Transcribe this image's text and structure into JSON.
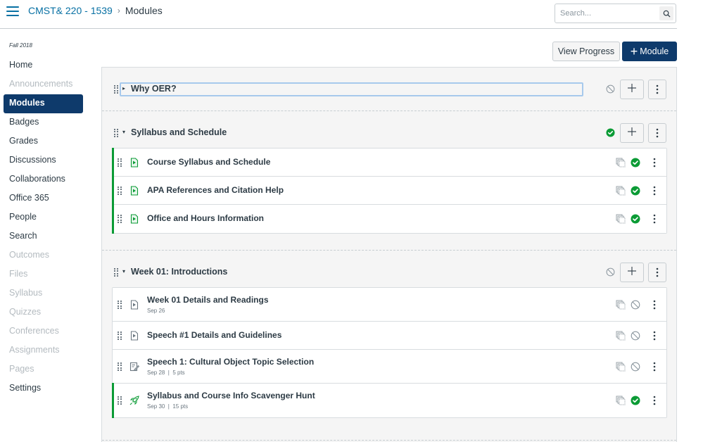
{
  "header": {
    "menu_icon": "hamburger-icon",
    "breadcrumbs": [
      {
        "label": "CMST& 220 - 1539",
        "link": true
      },
      {
        "label": "Modules",
        "link": false
      }
    ],
    "separator": "›",
    "search": {
      "placeholder": "Search...",
      "value": "",
      "icon": "search-icon"
    }
  },
  "sidebar": {
    "term": "Fall 2018",
    "items": [
      {
        "label": "Home",
        "state": "enabled"
      },
      {
        "label": "Announcements",
        "state": "disabled"
      },
      {
        "label": "Modules",
        "state": "active"
      },
      {
        "label": "Badges",
        "state": "enabled"
      },
      {
        "label": "Grades",
        "state": "enabled"
      },
      {
        "label": "Discussions",
        "state": "enabled"
      },
      {
        "label": "Collaborations",
        "state": "enabled"
      },
      {
        "label": "Office 365",
        "state": "enabled"
      },
      {
        "label": "People",
        "state": "enabled"
      },
      {
        "label": "Search",
        "state": "enabled"
      },
      {
        "label": "Outcomes",
        "state": "disabled"
      },
      {
        "label": "Files",
        "state": "disabled"
      },
      {
        "label": "Syllabus",
        "state": "disabled"
      },
      {
        "label": "Quizzes",
        "state": "disabled"
      },
      {
        "label": "Conferences",
        "state": "disabled"
      },
      {
        "label": "Assignments",
        "state": "disabled"
      },
      {
        "label": "Pages",
        "state": "disabled"
      },
      {
        "label": "Settings",
        "state": "enabled"
      }
    ]
  },
  "toolbar": {
    "view_progress_label": "View Progress",
    "add_module_label": "Module",
    "add_module_icon": "plus-icon"
  },
  "modules": [
    {
      "title": "Why OER?",
      "collapsed": true,
      "focused": true,
      "published": false,
      "items": []
    },
    {
      "title": "Syllabus and Schedule",
      "collapsed": false,
      "published": true,
      "items": [
        {
          "title": "Course Syllabus and Schedule",
          "type": "page",
          "icon": "page-icon",
          "meta": "",
          "published": true
        },
        {
          "title": "APA References and Citation Help",
          "type": "page",
          "icon": "page-icon",
          "meta": "",
          "published": true
        },
        {
          "title": "Office and Hours Information",
          "type": "page",
          "icon": "page-icon",
          "meta": "",
          "published": true
        }
      ]
    },
    {
      "title": "Week 01: Introductions",
      "collapsed": false,
      "published": false,
      "items": [
        {
          "title": "Week 01 Details and Readings",
          "type": "page",
          "icon": "page-icon",
          "meta": "Sep 26",
          "published": false
        },
        {
          "title": "Speech #1 Details and Guidelines",
          "type": "page",
          "icon": "page-icon",
          "meta": "",
          "published": false
        },
        {
          "title": "Speech 1: Cultural Object Topic Selection",
          "type": "assignment",
          "icon": "assignment-icon",
          "meta": "Sep 28  |  5 pts",
          "published": false
        },
        {
          "title": "Syllabus and Course Info Scavenger Hunt",
          "type": "quiz",
          "icon": "rocket-icon",
          "meta": "Sep 30  |  15 pts",
          "published": true
        }
      ]
    }
  ],
  "colors": {
    "link": "#0770a3",
    "active_nav": "#0e3a6b",
    "published": "#0b9b35",
    "unpublished": "#8b969e",
    "focus_outline": "#a7c9ec"
  }
}
